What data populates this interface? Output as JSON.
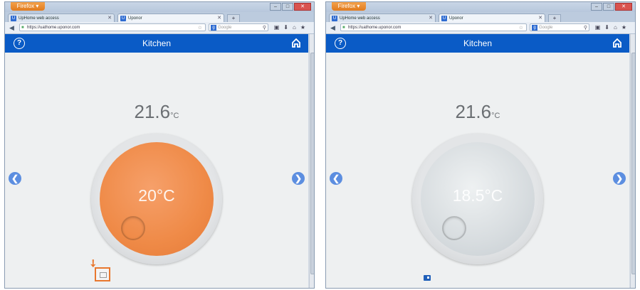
{
  "windows": [
    {
      "firefox_label": "Firefox ▾",
      "tabs": [
        "UpHome web access",
        "Uponor"
      ],
      "url": "https://uathome.uponor.com",
      "search_placeholder": "Google",
      "room": "Kitchen",
      "current_temp": "21.6",
      "current_unit": "°C",
      "setpoint": "20°C",
      "heating": true
    },
    {
      "firefox_label": "Firefox ▾",
      "tabs": [
        "UpHome web access",
        "Uponor"
      ],
      "url": "https://uathome.uponor.com",
      "search_placeholder": "Google",
      "room": "Kitchen",
      "current_temp": "21.6",
      "current_unit": "°C",
      "setpoint": "18.5°C",
      "heating": false
    }
  ],
  "icons": {
    "help": "?",
    "prev": "❮",
    "next": "❯",
    "minimize": "–",
    "maximize": "□",
    "close": "✕",
    "new_tab": "+",
    "back": "◀"
  },
  "colors": {
    "header": "#0a5bc6",
    "heating_dial": "#ef8a47",
    "idle_dial": "#d7dcdf",
    "highlight": "#e8772e"
  }
}
